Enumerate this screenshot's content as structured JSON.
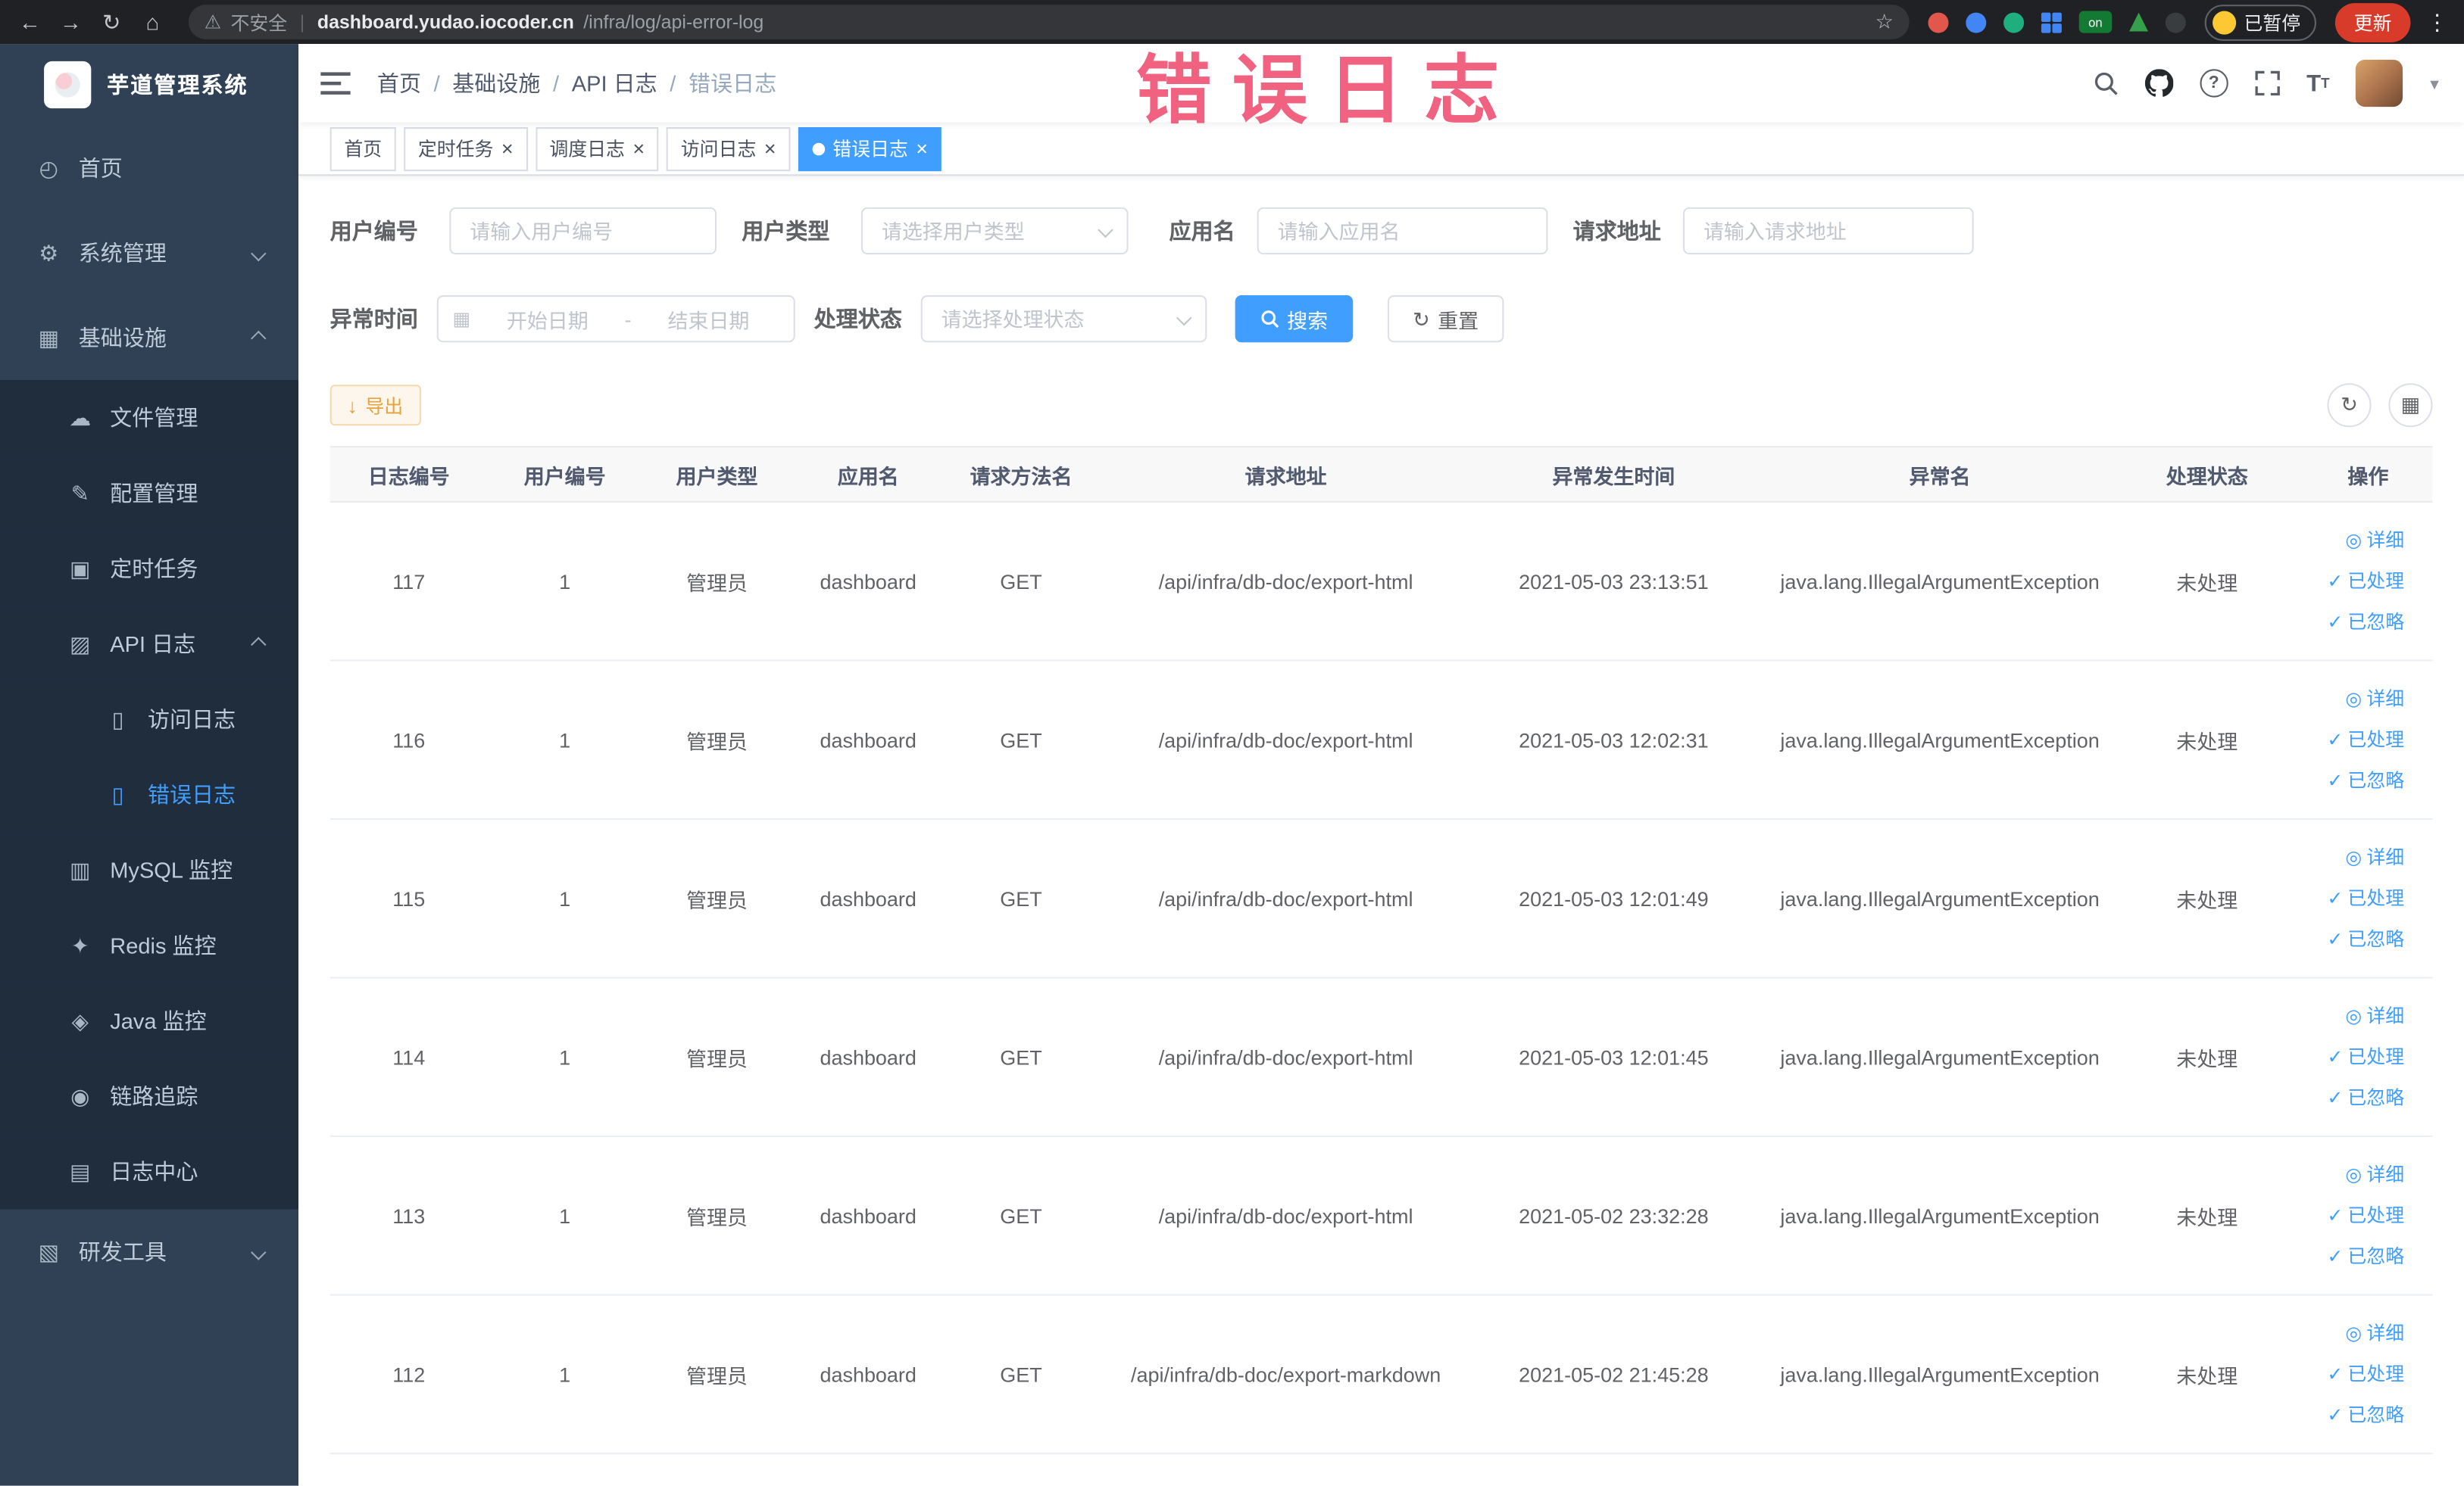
{
  "colors": {
    "accent": "#409eff",
    "sidebar_bg": "#304156",
    "submenu_bg": "#1f2d3d",
    "warning": "#e6a23c",
    "annotation": "#ee4d6e"
  },
  "browser": {
    "security_label": "不安全",
    "url_host": "dashboard.yudao.iocoder.cn",
    "url_path": "/infra/log/api-error-log",
    "extension_on_label": "on",
    "paused_label": "已暂停",
    "update_label": "更新"
  },
  "icons": {
    "back": "←",
    "forward": "→",
    "reload": "↻",
    "home": "⌂",
    "warning": "⚠",
    "star": "☆",
    "kebab": "⋮",
    "close": "×",
    "check": "✓",
    "view": "◎",
    "caret_down": "▾",
    "refresh": "↻",
    "columns": "▦",
    "download": "↓",
    "calendar": "▦",
    "menu": {
      "dashboard": "◴",
      "system": "⚙",
      "infra": "▦",
      "file": "☁",
      "config": "✎",
      "job": "▣",
      "apilog": "▨",
      "doc": "▯",
      "mysql": "▥",
      "redis": "✦",
      "java": "◈",
      "trace": "◉",
      "logcenter": "▤",
      "tools": "▧"
    }
  },
  "sidebar": {
    "title": "芋道管理系统",
    "items": [
      {
        "label": "首页"
      },
      {
        "label": "系统管理"
      },
      {
        "label": "基础设施"
      },
      {
        "label": "文件管理"
      },
      {
        "label": "配置管理"
      },
      {
        "label": "定时任务"
      },
      {
        "label": "API 日志"
      },
      {
        "label": "访问日志"
      },
      {
        "label": "错误日志"
      },
      {
        "label": "MySQL 监控"
      },
      {
        "label": "Redis 监控"
      },
      {
        "label": "Java 监控"
      },
      {
        "label": "链路追踪"
      },
      {
        "label": "日志中心"
      },
      {
        "label": "研发工具"
      }
    ]
  },
  "header": {
    "breadcrumb": [
      "首页",
      "基础设施",
      "API 日志",
      "错误日志"
    ]
  },
  "overlay": {
    "text": "错误日志"
  },
  "tabs": [
    {
      "label": "首页"
    },
    {
      "label": "定时任务"
    },
    {
      "label": "调度日志"
    },
    {
      "label": "访问日志"
    },
    {
      "label": "错误日志"
    }
  ],
  "filters": {
    "user_id": {
      "label": "用户编号",
      "placeholder": "请输入用户编号"
    },
    "user_type": {
      "label": "用户类型",
      "placeholder": "请选择用户类型"
    },
    "app_name": {
      "label": "应用名",
      "placeholder": "请输入应用名"
    },
    "request_url": {
      "label": "请求地址",
      "placeholder": "请输入请求地址"
    },
    "exception_time": {
      "label": "异常时间",
      "start_placeholder": "开始日期",
      "separator": "-",
      "end_placeholder": "结束日期"
    },
    "process_status": {
      "label": "处理状态",
      "placeholder": "请选择处理状态"
    },
    "search_label": "搜索",
    "reset_label": "重置"
  },
  "toolbar": {
    "export_label": "导出"
  },
  "table": {
    "columns": [
      "日志编号",
      "用户编号",
      "用户类型",
      "应用名",
      "请求方法名",
      "请求地址",
      "异常发生时间",
      "异常名",
      "处理状态",
      "操作"
    ],
    "actions": {
      "detail": "详细",
      "processed": "已处理",
      "ignored": "已忽略"
    },
    "rows": [
      {
        "log_id": "117",
        "user_id": "1",
        "user_type": "管理员",
        "app_name": "dashboard",
        "method": "GET",
        "url": "/api/infra/db-doc/export-html",
        "time": "2021-05-03 23:13:51",
        "exception": "java.lang.IllegalArgumentException",
        "status": "未处理"
      },
      {
        "log_id": "116",
        "user_id": "1",
        "user_type": "管理员",
        "app_name": "dashboard",
        "method": "GET",
        "url": "/api/infra/db-doc/export-html",
        "time": "2021-05-03 12:02:31",
        "exception": "java.lang.IllegalArgumentException",
        "status": "未处理"
      },
      {
        "log_id": "115",
        "user_id": "1",
        "user_type": "管理员",
        "app_name": "dashboard",
        "method": "GET",
        "url": "/api/infra/db-doc/export-html",
        "time": "2021-05-03 12:01:49",
        "exception": "java.lang.IllegalArgumentException",
        "status": "未处理"
      },
      {
        "log_id": "114",
        "user_id": "1",
        "user_type": "管理员",
        "app_name": "dashboard",
        "method": "GET",
        "url": "/api/infra/db-doc/export-html",
        "time": "2021-05-03 12:01:45",
        "exception": "java.lang.IllegalArgumentException",
        "status": "未处理"
      },
      {
        "log_id": "113",
        "user_id": "1",
        "user_type": "管理员",
        "app_name": "dashboard",
        "method": "GET",
        "url": "/api/infra/db-doc/export-html",
        "time": "2021-05-02 23:32:28",
        "exception": "java.lang.IllegalArgumentException",
        "status": "未处理"
      },
      {
        "log_id": "112",
        "user_id": "1",
        "user_type": "管理员",
        "app_name": "dashboard",
        "method": "GET",
        "url": "/api/infra/db-doc/export-markdown",
        "time": "2021-05-02 21:45:28",
        "exception": "java.lang.IllegalArgumentException",
        "status": "未处理"
      }
    ]
  }
}
